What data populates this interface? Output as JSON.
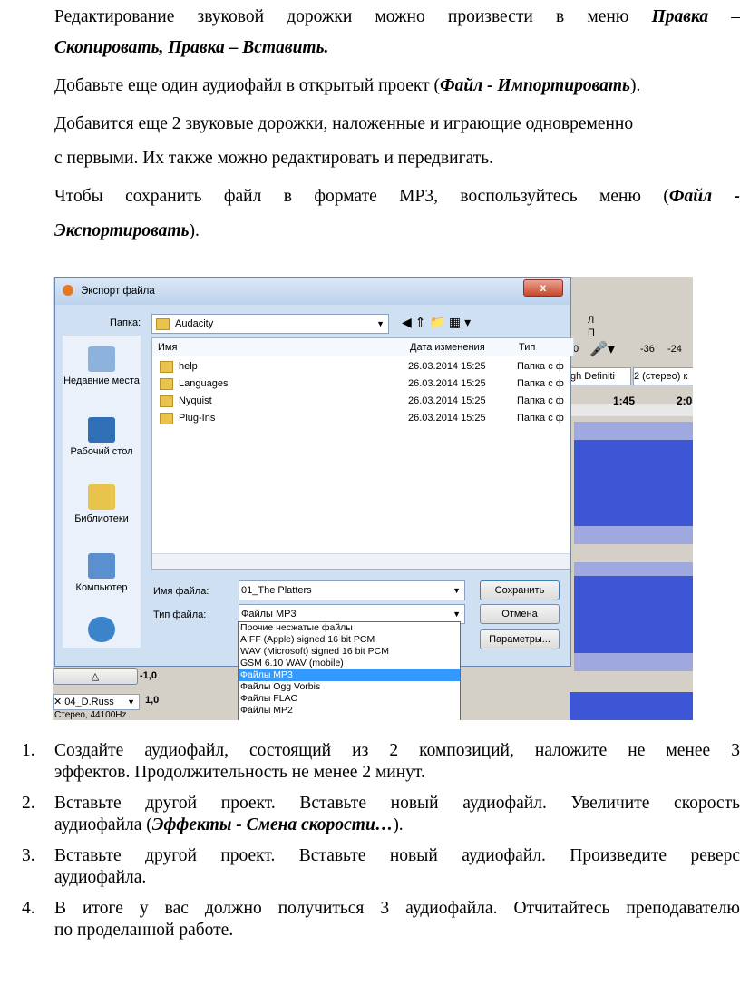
{
  "paragraphs": {
    "p1_a": "Редактирование звуковой дорожки можно произвести в меню",
    "p1_b": "Правка",
    "p1_c": "–",
    "p1_d": "Скопировать, Правка – Вставить.",
    "p2_a": "Добавьте еще один аудиофайл в открытый проект (",
    "p2_b": "Файл - Импортировать",
    "p2_c": ").",
    "p3_a": "Добавится еще 2 звуковые дорожки, наложенные и играющие одновременно",
    "p3_b": "с первыми. Их также можно редактировать и передвигать.",
    "p4_a": "Чтобы сохранить файл в формате МР3, воспользуйтесь меню (",
    "p4_b": "Файл -",
    "p4_c": "Экспортировать",
    "p4_d": ")."
  },
  "dialog": {
    "title": "Экспорт файла",
    "close": "x",
    "folder_label": "Папка:",
    "folder_value": "Audacity",
    "columns": [
      "Имя",
      "Дата изменения",
      "Тип"
    ],
    "files": [
      {
        "name": "help",
        "date": "26.03.2014 15:25",
        "type": "Папка с ф"
      },
      {
        "name": "Languages",
        "date": "26.03.2014 15:25",
        "type": "Папка с ф"
      },
      {
        "name": "Nyquist",
        "date": "26.03.2014 15:25",
        "type": "Папка с ф"
      },
      {
        "name": "Plug-Ins",
        "date": "26.03.2014 15:25",
        "type": "Папка с ф"
      }
    ],
    "places": [
      "Недавние места",
      "Рабочий стол",
      "Библиотеки",
      "Компьютер"
    ],
    "filename_label": "Имя файла:",
    "filename_value": "01_The Platters",
    "filetype_label": "Тип файла:",
    "filetype_value": "Файлы MP3",
    "save_button": "Сохранить",
    "cancel_button": "Отмена",
    "params_button": "Параметры...",
    "filetype_options": [
      "Прочие несжатые файлы",
      "AIFF (Apple) signed 16 bit PCM",
      "WAV (Microsoft) signed 16 bit PCM",
      "GSM 6.10 WAV (mobile)",
      "Файлы MP3",
      "Файлы Ogg Vorbis",
      "Файлы FLAC",
      "Файлы MP2"
    ]
  },
  "audacity": {
    "meter_l": "Л",
    "meter_r": "П",
    "zero": "0",
    "db1": "-36",
    "db2": "-24",
    "device": "gh Definiti",
    "channels": "2 (стерео) к",
    "time1": "1:45",
    "time2": "2:0",
    "track_name": "04_D.Russ",
    "track_info": "Стерео, 44100Hz",
    "val1": "-1,0",
    "val2": "1,0"
  },
  "tasks": [
    {
      "num": "1.",
      "l1": "Создайте аудиофайл, состоящий из 2 композиций, наложите не менее 3",
      "l2": "эффектов. Продолжительность не менее 2 минут."
    },
    {
      "num": "2.",
      "l1": "Вставьте другой проект. Вставьте новый аудиофайл. Увеличите скорость",
      "l2a": "аудиофайла (",
      "l2b": "Эффекты - Смена скорости…",
      "l2c": ")."
    },
    {
      "num": "3.",
      "l1": "Вставьте другой проект. Вставьте новый аудиофайл. Произведите реверс",
      "l2": "аудиофайла."
    },
    {
      "num": "4.",
      "l1": "В итоге у вас должно получиться 3 аудиофайла. Отчитайтесь преподавателю",
      "l2": "по проделанной работе."
    }
  ]
}
